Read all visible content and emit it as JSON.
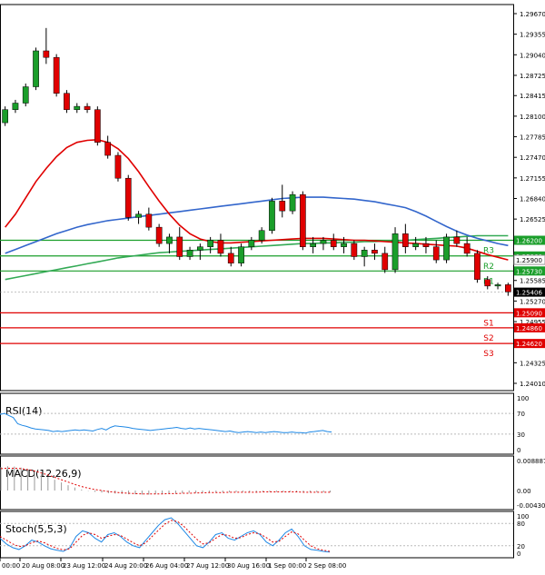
{
  "chart_data": [
    {
      "type": "candlestick",
      "price_axis_ticks": [
        "1.29670",
        "1.29355",
        "1.29040",
        "1.28725",
        "1.28415",
        "1.28100",
        "1.27785",
        "1.27470",
        "1.27155",
        "1.26840",
        "1.26525",
        "1.26215",
        "1.25900",
        "1.25585",
        "1.25270",
        "1.24955",
        "1.24640",
        "1.24325",
        "1.24010"
      ],
      "ylim": [
        1.2401,
        1.2967
      ],
      "time_labels": [
        "00:00",
        "20 Aug 08:00",
        "23 Aug 12:00",
        "24 Aug 20:00",
        "26 Aug 04:00",
        "27 Aug 12:00",
        "30 Aug 16:00",
        "1 Sep 00:00",
        "2 Sep 08:00"
      ],
      "candles": [
        [
          1.28,
          1.2825,
          1.2795,
          1.282
        ],
        [
          1.282,
          1.2835,
          1.2815,
          1.283
        ],
        [
          1.283,
          1.286,
          1.2825,
          1.2855
        ],
        [
          1.2855,
          1.2915,
          1.285,
          1.291
        ],
        [
          1.291,
          1.2945,
          1.289,
          1.29
        ],
        [
          1.29,
          1.2905,
          1.284,
          1.2845
        ],
        [
          1.2845,
          1.285,
          1.2815,
          1.282
        ],
        [
          1.282,
          1.283,
          1.2815,
          1.2825
        ],
        [
          1.2825,
          1.283,
          1.2815,
          1.282
        ],
        [
          1.282,
          1.2825,
          1.2765,
          1.277
        ],
        [
          1.277,
          1.278,
          1.2745,
          1.275
        ],
        [
          1.275,
          1.2755,
          1.271,
          1.2715
        ],
        [
          1.2715,
          1.272,
          1.265,
          1.2655
        ],
        [
          1.2655,
          1.2665,
          1.2645,
          1.266
        ],
        [
          1.266,
          1.267,
          1.2635,
          1.264
        ],
        [
          1.264,
          1.2645,
          1.261,
          1.2615
        ],
        [
          1.2615,
          1.263,
          1.26,
          1.2625
        ],
        [
          1.2625,
          1.264,
          1.259,
          1.2595
        ],
        [
          1.2595,
          1.261,
          1.259,
          1.2605
        ],
        [
          1.2605,
          1.2615,
          1.259,
          1.261
        ],
        [
          1.261,
          1.2625,
          1.26,
          1.262
        ],
        [
          1.262,
          1.263,
          1.2595,
          1.26
        ],
        [
          1.26,
          1.261,
          1.258,
          1.2585
        ],
        [
          1.2585,
          1.2615,
          1.258,
          1.261
        ],
        [
          1.261,
          1.2625,
          1.2605,
          1.262
        ],
        [
          1.262,
          1.264,
          1.2615,
          1.2635
        ],
        [
          1.2635,
          1.2685,
          1.263,
          1.268
        ],
        [
          1.268,
          1.2705,
          1.2655,
          1.2665
        ],
        [
          1.2665,
          1.2695,
          1.266,
          1.269
        ],
        [
          1.269,
          1.2695,
          1.2605,
          1.261
        ],
        [
          1.261,
          1.2625,
          1.26,
          1.2615
        ],
        [
          1.2615,
          1.2625,
          1.2605,
          1.262
        ],
        [
          1.262,
          1.263,
          1.2605,
          1.261
        ],
        [
          1.261,
          1.2625,
          1.26,
          1.2615
        ],
        [
          1.2615,
          1.262,
          1.259,
          1.2595
        ],
        [
          1.2595,
          1.261,
          1.258,
          1.2605
        ],
        [
          1.2605,
          1.2615,
          1.259,
          1.26
        ],
        [
          1.26,
          1.261,
          1.257,
          1.2575
        ],
        [
          1.2575,
          1.264,
          1.257,
          1.263
        ],
        [
          1.263,
          1.2645,
          1.26,
          1.261
        ],
        [
          1.261,
          1.2625,
          1.2605,
          1.2615
        ],
        [
          1.2615,
          1.2625,
          1.26,
          1.261
        ],
        [
          1.261,
          1.262,
          1.2585,
          1.259
        ],
        [
          1.259,
          1.263,
          1.2585,
          1.2625
        ],
        [
          1.2625,
          1.2635,
          1.261,
          1.2615
        ],
        [
          1.2615,
          1.2625,
          1.2595,
          1.26
        ],
        [
          1.26,
          1.2605,
          1.2555,
          1.256
        ],
        [
          1.256,
          1.2565,
          1.2545,
          1.255
        ],
        [
          1.255,
          1.2555,
          1.2545,
          1.2552
        ],
        [
          1.2552,
          1.2555,
          1.2535,
          1.2541
        ]
      ],
      "sma_red": [
        1.264,
        1.266,
        1.2685,
        1.271,
        1.273,
        1.2748,
        1.2762,
        1.277,
        1.2773,
        1.2774,
        1.277,
        1.276,
        1.2745,
        1.2725,
        1.2702,
        1.268,
        1.266,
        1.2643,
        1.263,
        1.2622,
        1.2618,
        1.2616,
        1.2616,
        1.2617,
        1.2618,
        1.2619,
        1.262,
        1.2621,
        1.2622,
        1.2623,
        1.2623,
        1.2623,
        1.2622,
        1.2621,
        1.262,
        1.262,
        1.2619,
        1.2618,
        1.2617,
        1.2616,
        1.2615,
        1.2614,
        1.2613,
        1.2612,
        1.2611,
        1.2608,
        1.2603,
        1.2598,
        1.2594,
        1.259
      ],
      "sma_blue": [
        1.26,
        1.2606,
        1.2612,
        1.2618,
        1.2624,
        1.263,
        1.2635,
        1.264,
        1.2644,
        1.2647,
        1.265,
        1.2652,
        1.2654,
        1.2656,
        1.2658,
        1.266,
        1.2662,
        1.2664,
        1.2666,
        1.2668,
        1.267,
        1.2672,
        1.2674,
        1.2676,
        1.2678,
        1.268,
        1.2682,
        1.2684,
        1.2685,
        1.2686,
        1.2686,
        1.2686,
        1.2685,
        1.2684,
        1.2683,
        1.2681,
        1.2679,
        1.2676,
        1.2673,
        1.267,
        1.2664,
        1.2657,
        1.2649,
        1.2641,
        1.2634,
        1.2628,
        1.2623,
        1.2619,
        1.2615,
        1.2612
      ],
      "sma_green": [
        1.256,
        1.2563,
        1.2566,
        1.2569,
        1.2572,
        1.2575,
        1.2578,
        1.2581,
        1.2584,
        1.2587,
        1.259,
        1.2593,
        1.2595,
        1.2597,
        1.2599,
        1.2601,
        1.2602,
        1.2603,
        1.2604,
        1.2605,
        1.2606,
        1.2607,
        1.2608,
        1.2609,
        1.261,
        1.2611,
        1.2612,
        1.2613,
        1.2614,
        1.2615,
        1.2615,
        1.2616,
        1.2616,
        1.2617,
        1.2617,
        1.2618,
        1.2618,
        1.2619,
        1.2619,
        1.262,
        1.2621,
        1.2622,
        1.2623,
        1.2624,
        1.2625,
        1.2626,
        1.2627,
        1.2627,
        1.2627,
        1.2627
      ],
      "levels": [
        {
          "name": "R3",
          "value": 1.262,
          "label": "1.26200",
          "color": "#1a9e2a"
        },
        {
          "name": "R2",
          "value": 1.2596,
          "label": "1.25960",
          "color": "#1a9e2a"
        },
        {
          "name": "R1",
          "value": 1.2573,
          "label": "1.25730",
          "color": "#1a9e2a"
        },
        {
          "name": "S1",
          "value": 1.2509,
          "label": "1.25090",
          "color": "#e00000"
        },
        {
          "name": "S2",
          "value": 1.2486,
          "label": "1.24860",
          "color": "#e00000"
        },
        {
          "name": "S3",
          "value": 1.2462,
          "label": "1.24620",
          "color": "#e00000"
        }
      ],
      "current_price": {
        "value": 1.25406,
        "label": "1.25406"
      },
      "extra_tag": {
        "value": 1.259,
        "label": "1.25900"
      },
      "colors": {
        "up": "#1a9e2a",
        "down": "#e00000",
        "red_ma": "#e00000",
        "blue_ma": "#3366cc",
        "green_ma": "#33aa55",
        "grid": "#cccccc"
      }
    },
    {
      "type": "line",
      "name": "RSI(14)",
      "ylim": [
        0,
        100
      ],
      "ticks": [
        "100",
        "70",
        "30",
        "0"
      ],
      "levels": [
        70,
        30
      ],
      "values": [
        68,
        70,
        66,
        62,
        50,
        47,
        45,
        42,
        40,
        39,
        38,
        37,
        35,
        36,
        35,
        36,
        37,
        38,
        37,
        38,
        37,
        36,
        39,
        41,
        38,
        43,
        46,
        45,
        44,
        43,
        41,
        40,
        39,
        38,
        37,
        38,
        39,
        40,
        41,
        42,
        43,
        41,
        40,
        42,
        40,
        41,
        40,
        39,
        38,
        37,
        36,
        35,
        36,
        34,
        33,
        34,
        35,
        34,
        33,
        34,
        33,
        34,
        35,
        34,
        33,
        33,
        34,
        33,
        33,
        32,
        34,
        35,
        36,
        37,
        35,
        34
      ]
    },
    {
      "type": "bar",
      "name": "MACD(12,26,9)",
      "ylim": [
        -0.004303,
        0.008887
      ],
      "ticks": [
        "0.008887",
        "0.00",
        "-0.004303"
      ],
      "hist": [
        0.007,
        0.0072,
        0.0071,
        0.0068,
        0.0063,
        0.0056,
        0.0048,
        0.004,
        0.0032,
        0.0024,
        0.0016,
        0.0009,
        0.0003,
        -0.0001,
        -0.0004,
        -0.0006,
        -0.0008,
        -0.0009,
        -0.001,
        -0.0011,
        -0.0011,
        -0.0012,
        -0.0012,
        -0.0011,
        -0.0011,
        -0.001,
        -0.0009,
        -0.0008,
        -0.0007,
        -0.0007,
        -0.0006,
        -0.0006,
        -0.0005,
        -0.0005,
        -0.0005,
        -0.0004,
        -0.0004,
        -0.0004,
        -0.0004,
        -0.0004,
        -0.0004,
        -0.0004,
        -0.0004,
        -0.0004,
        -0.0004,
        -0.0004,
        -0.0005,
        -0.0005,
        -0.0005,
        -0.0005
      ],
      "signal": [
        0.0065,
        0.0066,
        0.0066,
        0.0065,
        0.0062,
        0.0058,
        0.0052,
        0.0046,
        0.0039,
        0.0032,
        0.0025,
        0.0018,
        0.0012,
        0.0007,
        0.0003,
        0.0,
        -0.0003,
        -0.0005,
        -0.0007,
        -0.0008,
        -0.0009,
        -0.001,
        -0.001,
        -0.001,
        -0.001,
        -0.0009,
        -0.0009,
        -0.0008,
        -0.0008,
        -0.0007,
        -0.0007,
        -0.0006,
        -0.0006,
        -0.0006,
        -0.0005,
        -0.0005,
        -0.0005,
        -0.0005,
        -0.0005,
        -0.0004,
        -0.0004,
        -0.0004,
        -0.0004,
        -0.0004,
        -0.0004,
        -0.0005,
        -0.0005,
        -0.0005,
        -0.0005,
        -0.0005
      ]
    },
    {
      "type": "line",
      "name": "Stoch(5,5,3)",
      "ylim": [
        0,
        100
      ],
      "ticks": [
        "100",
        "80",
        "20",
        "0"
      ],
      "levels": [
        80,
        20
      ],
      "k": [
        40,
        25,
        15,
        10,
        20,
        35,
        30,
        20,
        12,
        8,
        5,
        15,
        45,
        60,
        55,
        40,
        30,
        50,
        55,
        45,
        30,
        20,
        15,
        35,
        55,
        75,
        90,
        95,
        80,
        60,
        40,
        20,
        15,
        30,
        50,
        55,
        40,
        35,
        45,
        55,
        60,
        50,
        30,
        20,
        35,
        55,
        65,
        45,
        20,
        10,
        8,
        5,
        3
      ],
      "d": [
        45,
        35,
        25,
        18,
        20,
        28,
        33,
        28,
        20,
        13,
        9,
        12,
        30,
        48,
        55,
        50,
        40,
        45,
        50,
        48,
        38,
        28,
        20,
        28,
        45,
        62,
        78,
        88,
        85,
        72,
        55,
        38,
        25,
        28,
        40,
        50,
        48,
        40,
        42,
        50,
        55,
        52,
        42,
        30,
        32,
        45,
        57,
        52,
        35,
        20,
        12,
        8,
        5
      ]
    }
  ]
}
